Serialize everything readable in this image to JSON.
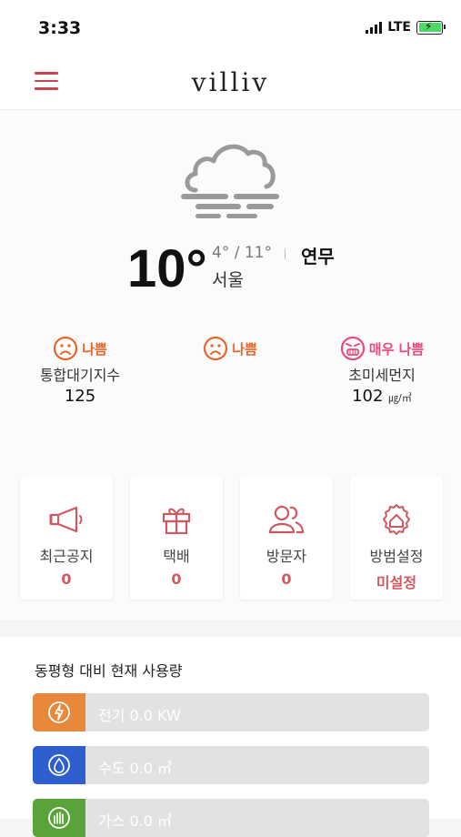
{
  "status": {
    "time": "3:33",
    "network": "LTE"
  },
  "header": {
    "logo": "villiv"
  },
  "weather": {
    "temp": "10°",
    "range": "4° / 11°",
    "city": "서울",
    "condition": "연무"
  },
  "air": [
    {
      "level": "나쁨",
      "label": "통합대기지수",
      "value": "125",
      "unit": "",
      "color": "#e8652c",
      "face": "sad-face-icon"
    },
    {
      "level": "나쁨",
      "label": "",
      "value": "",
      "unit": "",
      "color": "#e8652c",
      "face": "sad-face-icon"
    },
    {
      "level": "매우 나쁨",
      "label": "초미세먼지",
      "value": "102",
      "unit": "㎍/㎥",
      "color": "#e84a7a",
      "face": "very-bad-face-icon"
    }
  ],
  "cards": [
    {
      "label": "최근공지",
      "count": "0",
      "icon": "megaphone-icon"
    },
    {
      "label": "택배",
      "count": "0",
      "icon": "gift-box-icon"
    },
    {
      "label": "방문자",
      "count": "0",
      "icon": "visitors-icon"
    },
    {
      "label": "방범설정",
      "count": "미설정",
      "icon": "security-gear-house-icon"
    }
  ],
  "usage": {
    "title": "동평형 대비 현재 사용량",
    "items": [
      {
        "label": "전기  0.0 KW",
        "color": "#e8883a",
        "icon": "electricity-icon"
      },
      {
        "label": "수도  0.0 ㎥",
        "color": "#2f5fcf",
        "icon": "water-drop-icon"
      },
      {
        "label": "가스  0.0 ㎥",
        "color": "#5aa23a",
        "icon": "gas-icon"
      }
    ]
  },
  "colors": {
    "accent": "#c84650",
    "count": "#d05860"
  }
}
